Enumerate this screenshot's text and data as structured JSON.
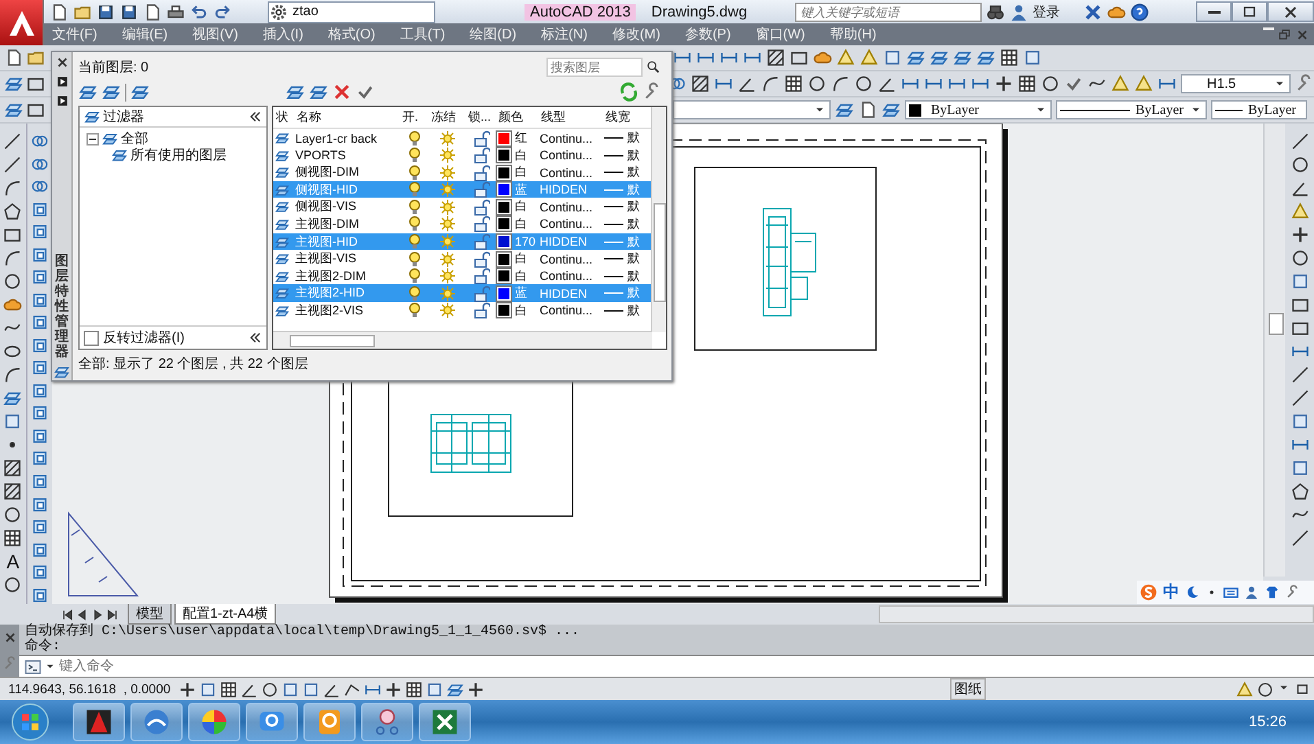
{
  "title_bar": {
    "workspace": "ztao",
    "app_title": "AutoCAD 2013",
    "document": "Drawing5.dwg",
    "search": {
      "placeholder": "键入关键字或短语"
    },
    "sign_in": "登录"
  },
  "menu_bar": [
    "文件(F)",
    "编辑(E)",
    "视图(V)",
    "插入(I)",
    "格式(O)",
    "工具(T)",
    "绘图(D)",
    "标注(N)",
    "修改(M)",
    "参数(P)",
    "窗口(W)",
    "帮助(H)"
  ],
  "toolbars": {
    "text_style": "H1.5",
    "layer_color": "ByLayer",
    "linetype": "ByLayer",
    "lineweight": "ByLayer"
  },
  "left_toolbar": {
    "text_tool": "A"
  },
  "layer_palette": {
    "vertical_title": "图层特性管理器",
    "current_layer": "当前图层: 0",
    "search": {
      "placeholder": "搜索图层"
    },
    "filter_header": "过滤器",
    "filter_tree": [
      {
        "label": "全部",
        "expanded": true,
        "children": [
          {
            "label": "所有使用的图层"
          }
        ]
      }
    ],
    "invert_filter": {
      "label": "反转过滤器(I)",
      "checked": false
    },
    "columns": [
      "状",
      "名称",
      "开.",
      "冻结",
      "锁...",
      "颜色",
      "线型",
      "线宽"
    ],
    "layers": [
      {
        "name": "Layer1-cr back",
        "selected": false,
        "on": true,
        "frozen": false,
        "locked": false,
        "color": "#ff0000",
        "color_name": "红",
        "linetype": "Continu...",
        "lineweight": "默"
      },
      {
        "name": "VPORTS",
        "selected": false,
        "on": true,
        "frozen": false,
        "locked": false,
        "color": "#000000",
        "color_name": "白",
        "linetype": "Continu...",
        "lineweight": "默"
      },
      {
        "name": "侧视图-DIM",
        "selected": false,
        "on": true,
        "frozen": false,
        "locked": false,
        "color": "#000000",
        "color_name": "白",
        "linetype": "Continu...",
        "lineweight": "默"
      },
      {
        "name": "侧视图-HID",
        "selected": true,
        "on": true,
        "frozen": false,
        "locked": false,
        "color": "#0000ff",
        "color_name": "蓝",
        "linetype": "HIDDEN",
        "lineweight": "默"
      },
      {
        "name": "侧视图-VIS",
        "selected": false,
        "on": true,
        "frozen": false,
        "locked": false,
        "color": "#000000",
        "color_name": "白",
        "linetype": "Continu...",
        "lineweight": "默"
      },
      {
        "name": "主视图-DIM",
        "selected": false,
        "on": true,
        "frozen": false,
        "locked": false,
        "color": "#000000",
        "color_name": "白",
        "linetype": "Continu...",
        "lineweight": "默"
      },
      {
        "name": "主视图-HID",
        "selected": true,
        "on": true,
        "frozen": false,
        "locked": false,
        "color": "#0010d0",
        "color_name": "170",
        "linetype": "HIDDEN",
        "lineweight": "默"
      },
      {
        "name": "主视图-VIS",
        "selected": false,
        "on": true,
        "frozen": false,
        "locked": false,
        "color": "#000000",
        "color_name": "白",
        "linetype": "Continu...",
        "lineweight": "默"
      },
      {
        "name": "主视图2-DIM",
        "selected": false,
        "on": true,
        "frozen": false,
        "locked": false,
        "color": "#000000",
        "color_name": "白",
        "linetype": "Continu...",
        "lineweight": "默"
      },
      {
        "name": "主视图2-HID",
        "selected": true,
        "on": true,
        "frozen": false,
        "locked": false,
        "color": "#0000ff",
        "color_name": "蓝",
        "linetype": "HIDDEN",
        "lineweight": "默"
      },
      {
        "name": "主视图2-VIS",
        "selected": false,
        "on": true,
        "frozen": false,
        "locked": false,
        "color": "#000000",
        "color_name": "白",
        "linetype": "Continu...",
        "lineweight": "默"
      }
    ],
    "status": "全部: 显示了 22 个图层 , 共 22 个图层"
  },
  "layout_tabs": [
    {
      "label": "模型",
      "selected": false
    },
    {
      "label": "配置1-zt-A4横",
      "selected": true
    }
  ],
  "command_line": {
    "history": [
      "自动保存到 C:\\Users\\user\\appdata\\local\\temp\\Drawing5_1_1_4560.sv$ ...",
      "命令:"
    ],
    "input": {
      "placeholder": "键入命令"
    }
  },
  "status_bar": {
    "coordinates": "114.9643, 56.1618  , 0.0000",
    "space": "图纸"
  },
  "ime_bar": {
    "language": "中"
  },
  "taskbar": {
    "clock": "15:26"
  }
}
